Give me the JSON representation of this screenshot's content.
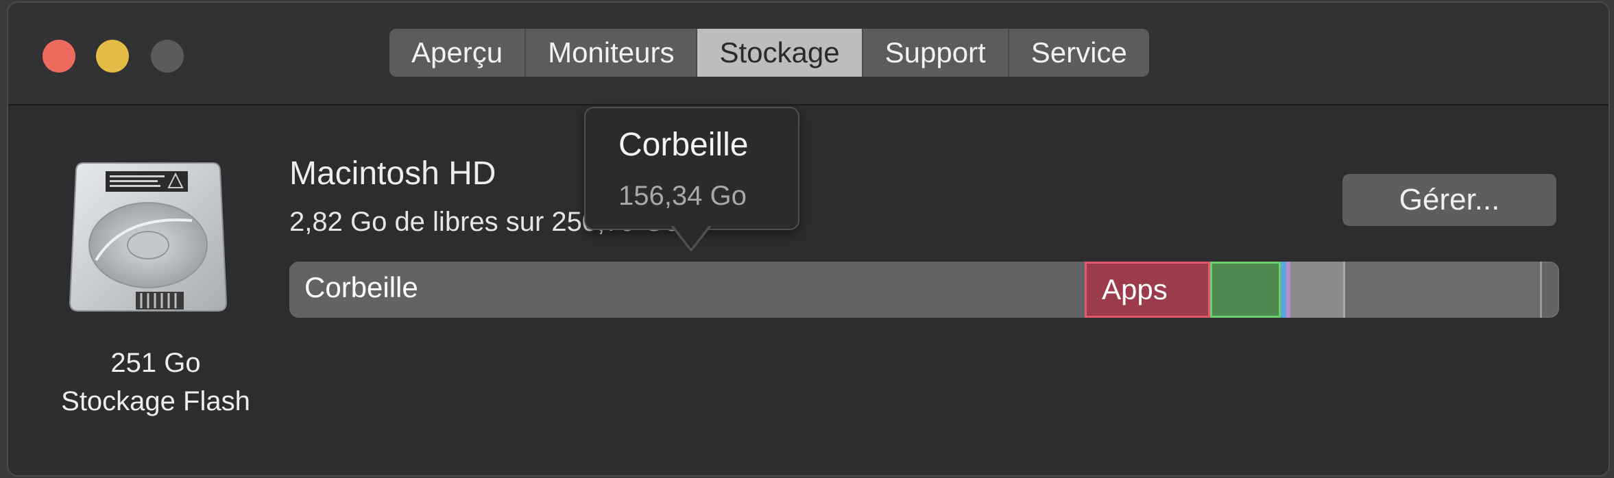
{
  "tabs": [
    {
      "label": "Aperçu",
      "active": false
    },
    {
      "label": "Moniteurs",
      "active": false
    },
    {
      "label": "Stockage",
      "active": true
    },
    {
      "label": "Support",
      "active": false
    },
    {
      "label": "Service",
      "active": false
    }
  ],
  "drive": {
    "size": "251 Go",
    "type": "Stockage Flash",
    "icon": "hard-drive-icon"
  },
  "volume": {
    "name": "Macintosh HD",
    "free_text": "2,82 Go de libres sur 250,79 Go"
  },
  "manage_label": "Gérer...",
  "storage_bar": {
    "segments": [
      {
        "label": "Corbeille",
        "color": "#636366"
      },
      {
        "label": "Apps",
        "color": "#9b3b4c"
      },
      {
        "label": "",
        "color": "#4f8a50"
      },
      {
        "label": "",
        "color": "#5aa6d6"
      },
      {
        "label": "",
        "color": "#b68fd0"
      },
      {
        "label": "",
        "color": "#8a8a8d"
      },
      {
        "label": "",
        "color": "#6b6b6e"
      }
    ]
  },
  "tooltip": {
    "title": "Corbeille",
    "value": "156,34 Go"
  },
  "window_controls": {
    "close_color": "#ed6a5e",
    "minimize_color": "#e3bc48",
    "zoom_color": "#5b5b5e"
  }
}
